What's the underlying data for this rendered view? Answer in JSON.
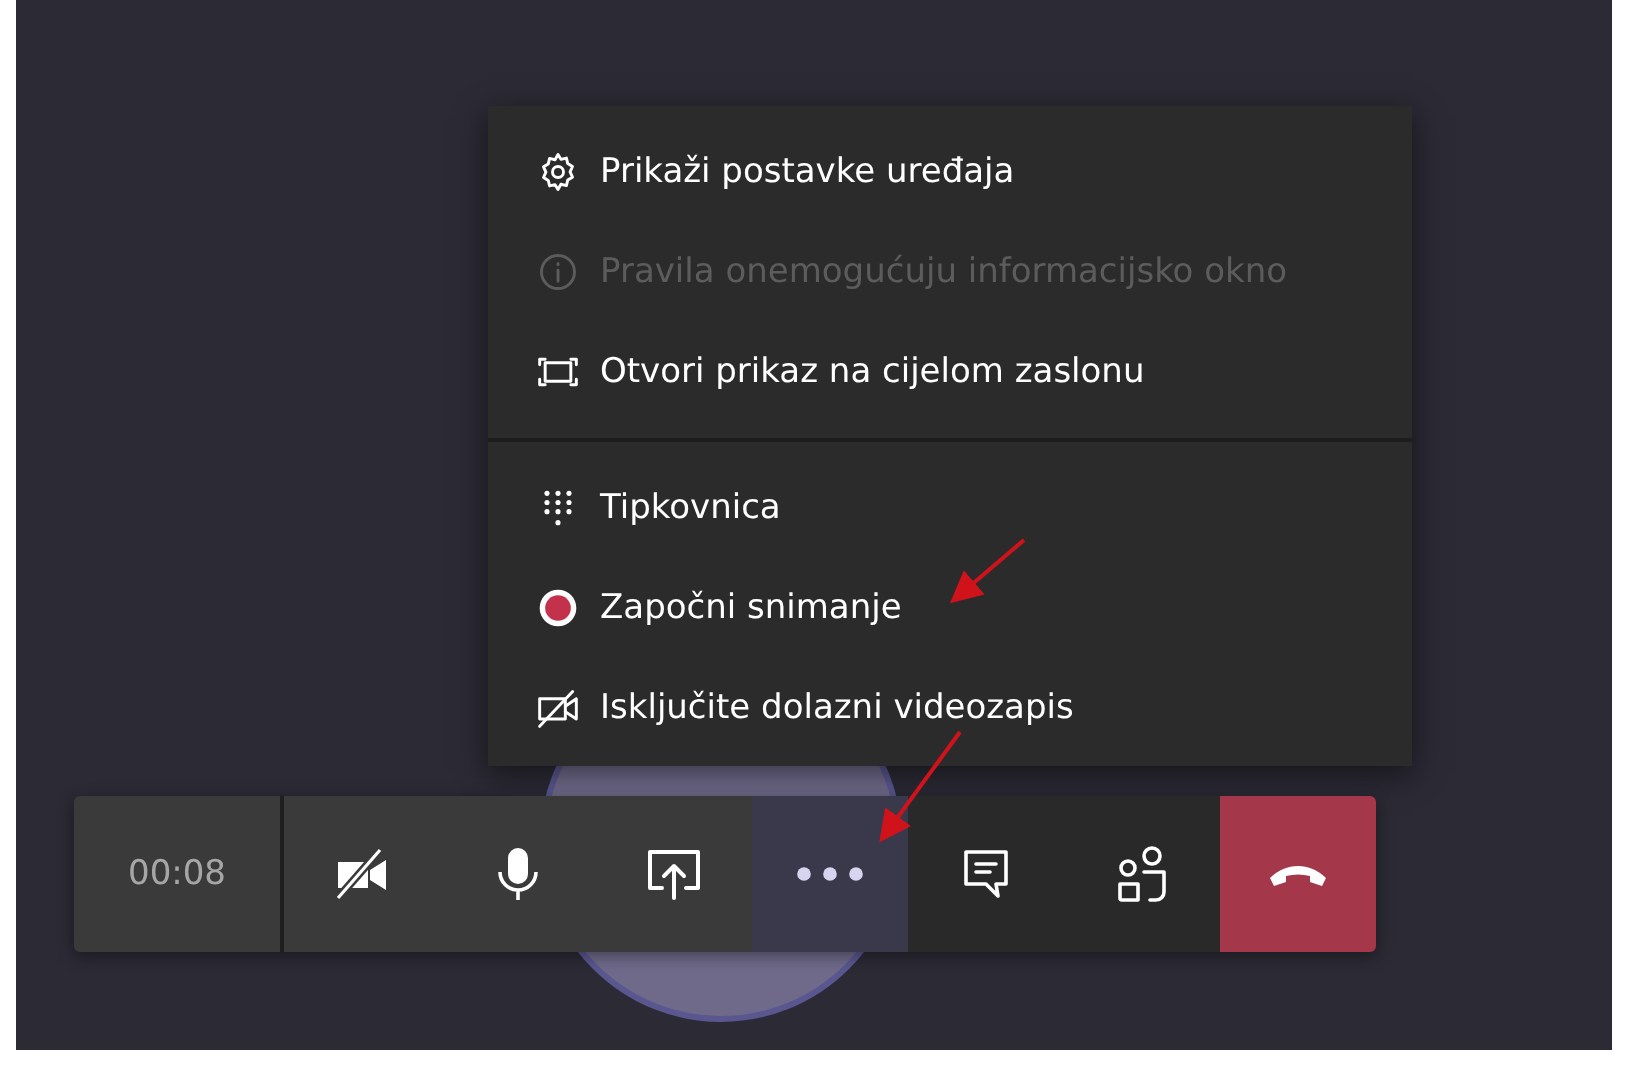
{
  "menu": {
    "sections": [
      {
        "items": [
          {
            "label": "Prikaži postavke uređaja",
            "disabled": false
          },
          {
            "label": "Pravila onemogućuju informacijsko okno",
            "disabled": true
          },
          {
            "label": "Otvori prikaz na cijelom zaslonu",
            "disabled": false
          }
        ]
      },
      {
        "items": [
          {
            "label": "Tipkovnica",
            "disabled": false
          },
          {
            "label": "Započni snimanje",
            "disabled": false
          },
          {
            "label": "Isključite dolazni videozapis",
            "disabled": false
          }
        ]
      }
    ]
  },
  "call_bar": {
    "timer": "00:08",
    "buttons": [
      {
        "kind": "camera",
        "selected": false
      },
      {
        "kind": "mic",
        "selected": false
      },
      {
        "kind": "share",
        "selected": false
      },
      {
        "kind": "more",
        "selected": true
      },
      {
        "kind": "chat",
        "selected": false
      },
      {
        "kind": "people",
        "selected": false
      },
      {
        "kind": "hangup",
        "selected": false
      }
    ]
  }
}
